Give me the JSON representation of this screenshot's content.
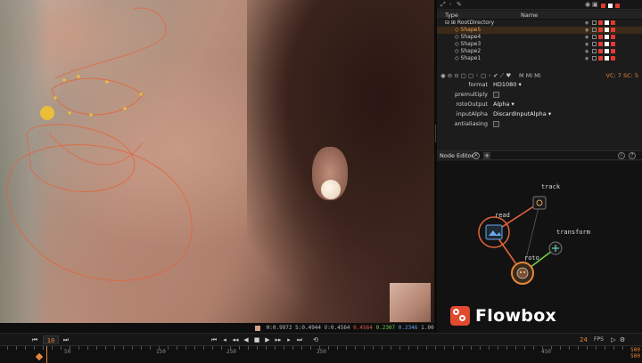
{
  "viewer": {
    "pixel_info": {
      "hsv": "H:0.9972 S:0.4944 V:0.4564",
      "r": "0.4564",
      "g": "0.2307",
      "b": "0.2346",
      "a": "1.0000",
      "swatch_color": "#d3a187"
    }
  },
  "panel": {
    "tree": {
      "header_type": "Type",
      "header_name": "Name",
      "root": "RootDirectory",
      "items": [
        {
          "label": "Shape5",
          "selected": true
        },
        {
          "label": "Shape4",
          "selected": false
        },
        {
          "label": "Shape3",
          "selected": false
        },
        {
          "label": "Shape2",
          "selected": false
        },
        {
          "label": "Shape1",
          "selected": false
        }
      ],
      "toolbar_text": "M  Mi  Mi",
      "counts": "VC: 7  SC: 5"
    },
    "properties": {
      "format_label": "format",
      "format_value": "HD1080",
      "premultiply_label": "premultiply",
      "roto_output_label": "rotoOutput",
      "roto_output_value": "Alpha",
      "input_alpha_label": "inputAlpha",
      "input_alpha_value": "DiscardInputAlpha",
      "antialiasing_label": "antialiasing"
    },
    "node_editor": {
      "tab_label": "Node Editor",
      "nodes": {
        "track": "track",
        "read": "read",
        "transform": "transform",
        "roto": "roto"
      }
    }
  },
  "timeline": {
    "current_frame": "10",
    "fps_value": "24",
    "fps_label": "FPS",
    "end_frame_top": "500",
    "end_frame_bottom": "500",
    "ruler_labels": [
      "50",
      "150",
      "250",
      "350",
      "450"
    ]
  },
  "brand": {
    "wordmark": "Flowbox",
    "accent": "#e6863c",
    "logo_color": "#e04a2f"
  }
}
